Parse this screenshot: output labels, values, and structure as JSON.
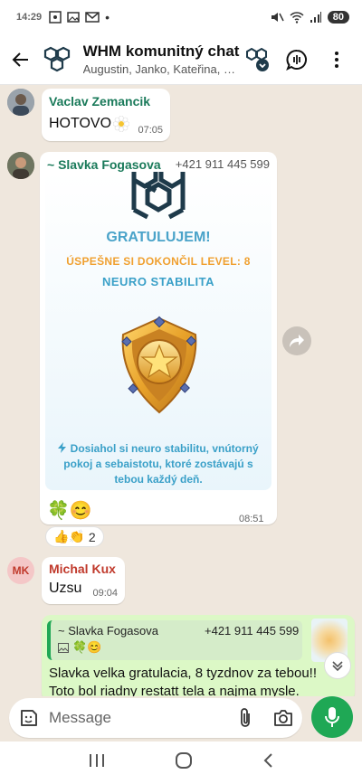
{
  "status_bar": {
    "time": "14:29",
    "battery": "80"
  },
  "header": {
    "title": "WHM komunitný chat",
    "subtitle": "Augustin, Janko, Kateřina, Mir..."
  },
  "messages": {
    "m1": {
      "sender": "Vaclav Zemancik",
      "text": "HOTOVO",
      "time": "07:05"
    },
    "m2": {
      "sender": "~ Slavka Fogasova",
      "phone": "+421 911 445 599",
      "card": {
        "title": "GRATULUJEM!",
        "level": "ÚSPEŠNE SI DOKONČIL LEVEL: 8",
        "subtitle": "NEURO STABILITA",
        "description": "Dosiahol si neuro stabilitu, vnútorný pokoj a sebaistotu, ktoré zostávajú s tebou každý deň."
      },
      "caption": "🍀😊",
      "time": "08:51",
      "reactions": {
        "emojis": "👍👏",
        "count": "2"
      }
    },
    "m3": {
      "sender": "Michal Kux",
      "initials": "MK",
      "text": "Uzsu",
      "time": "09:04"
    },
    "m4": {
      "quoted_sender": "~ Slavka Fogasova",
      "quoted_phone": "+421 911 445 599",
      "quoted_text": "🍀😊",
      "text_line1": "Slavka  velka gratulacia, 8 tyzdnov za tebou!!",
      "text_line2": "Toto bol riadny restatt tela a najma mysle."
    }
  },
  "composer": {
    "placeholder": "Message"
  },
  "colors": {
    "accent": "#1fa855",
    "sender_green": "#1a7a5a",
    "sender_red": "#c0392b"
  }
}
